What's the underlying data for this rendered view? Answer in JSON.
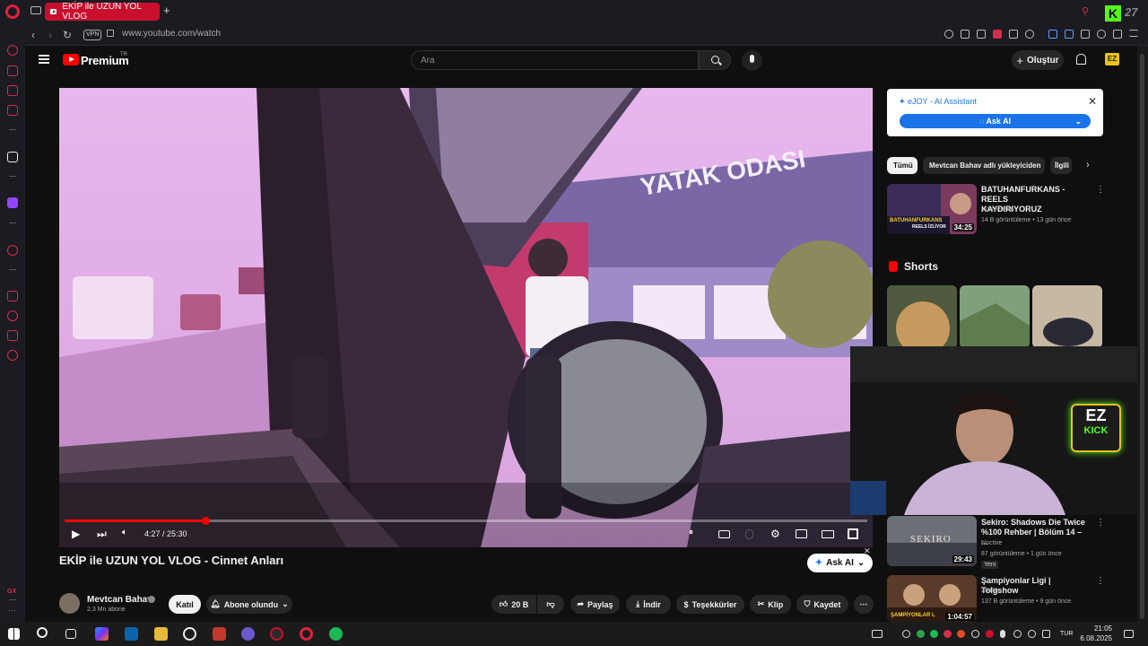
{
  "browser": {
    "tab_title": "EKİP ile UZUN YOL VLOG",
    "url": "www.youtube.com/watch",
    "vpn_badge": "VPN"
  },
  "youtube": {
    "brand": "Premium",
    "region": "TR",
    "search_placeholder": "Ara",
    "create_label": "Oluştur"
  },
  "player": {
    "time": "4:27 / 25:30",
    "progress_fraction": 0.175,
    "overlay_text": "YATAK ODASI"
  },
  "video": {
    "title": "EKİP ile UZUN YOL VLOG - Cinnet Anları",
    "ask_ai_label": "Ask AI",
    "channel": {
      "name": "Mevtcan Bahav",
      "subscribers": "2,3 Mn abone",
      "join_label": "Katıl",
      "subscribed_label": "Abone olundu"
    },
    "actions": {
      "likes": "20 B",
      "share": "Paylaş",
      "download": "İndir",
      "thanks": "Teşekkürler",
      "clip": "Klip",
      "save": "Kaydet"
    }
  },
  "ejoy": {
    "title": "eJOY - AI Assistant",
    "button": "Ask AI"
  },
  "chips": [
    {
      "label": "Tümü"
    },
    {
      "label": "Mevtcan Bahav adlı yükleyiciden"
    },
    {
      "label": "İlgili"
    }
  ],
  "recommendations": [
    {
      "title_line1": "BATUHANFURKANS - REELS",
      "title_line2": "KAYDIRIYORUZ",
      "channel": "kickmeister",
      "meta": "14 B görüntüleme • 13 gün önce",
      "duration": "34:25",
      "thumb_caption": "BATUHANFURKANS",
      "thumb_caption2": "REELS İZLİYOR"
    },
    {
      "title_line1": "Sekiro: Shadows Die Twice",
      "title_line2": "%100 Rehber | Bölüm 14 – ...",
      "channel": "Noctive",
      "meta": "87 görüntüleme • 1 gün önce",
      "badge": "Yeni",
      "duration": "29:43",
      "thumb_caption": "SEKIRO"
    },
    {
      "title_line1": "Şampiyonlar Ligi | Tolgshow",
      "channel": "25 Film",
      "meta": "137 B görüntüleme • 9 gün önce",
      "duration": "1:04:57",
      "thumb_caption": "ŞAMPİYONLAR L"
    }
  ],
  "shorts": {
    "label": "Shorts"
  },
  "webcam": {
    "badge_line1": "EZ",
    "badge_line2": "KICK"
  },
  "taskbar": {
    "time": "21:05",
    "date": "6.08.2025",
    "language": "TUR"
  },
  "colors": {
    "accent_red": "#ff0000",
    "opera_red": "#c8102e",
    "ejoy_blue": "#1a73e8",
    "kick_green": "#53fc18"
  }
}
